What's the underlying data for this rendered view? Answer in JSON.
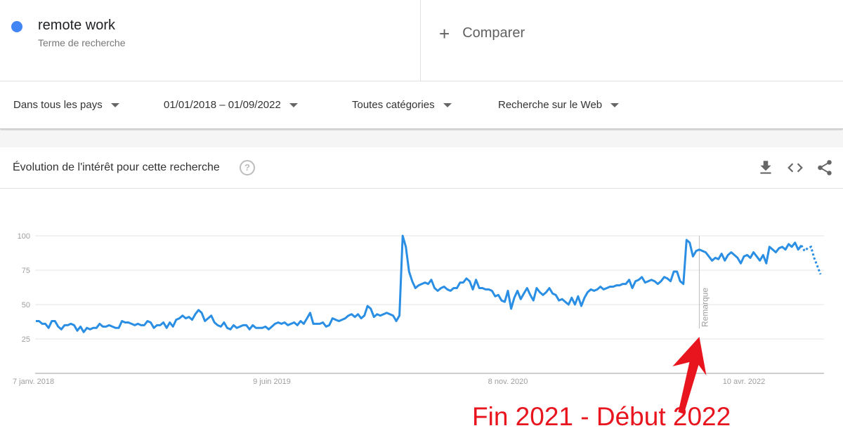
{
  "search_term": {
    "name": "remote work",
    "subtitle": "Terme de recherche",
    "color": "#4285f4"
  },
  "compare": {
    "label": "Comparer",
    "icon": "plus-icon"
  },
  "filters": {
    "region": "Dans tous les pays",
    "date_range": "01/01/2018 – 01/09/2022",
    "category": "Toutes catégories",
    "search_type": "Recherche sur le Web"
  },
  "card": {
    "title": "Évolution de l'intérêt pour cette recherche",
    "help_icon": "?",
    "actions": [
      "download-icon",
      "embed-icon",
      "share-icon"
    ]
  },
  "annotation": {
    "text": "Fin 2021 - Début 2022",
    "color": "#e8141e"
  },
  "chart_data": {
    "type": "line",
    "title": "Évolution de l'intérêt pour cette recherche",
    "xlabel": "",
    "ylabel": "",
    "ylim": [
      0,
      100
    ],
    "yticks": [
      25,
      50,
      75,
      100
    ],
    "xtick_labels": [
      "7 janv. 2018",
      "9 juin 2019",
      "8 nov. 2020",
      "10 avr. 2022"
    ],
    "xtick_index": [
      0,
      74,
      148,
      222
    ],
    "grid": true,
    "note_marker": {
      "label": "Remarque",
      "index": 208
    },
    "partial_data_from_index": 240,
    "series": [
      {
        "name": "remote work",
        "color": "#2a8fe4",
        "values": [
          38,
          38,
          36,
          36,
          33,
          38,
          38,
          34,
          32,
          35,
          35,
          36,
          35,
          31,
          34,
          30,
          33,
          32,
          33,
          33,
          36,
          34,
          34,
          35,
          34,
          33,
          33,
          38,
          37,
          37,
          36,
          35,
          36,
          35,
          35,
          38,
          37,
          33,
          35,
          35,
          37,
          33,
          37,
          34,
          39,
          40,
          42,
          40,
          41,
          39,
          43,
          46,
          44,
          38,
          40,
          42,
          37,
          35,
          34,
          37,
          33,
          32,
          35,
          33,
          34,
          35,
          35,
          32,
          35,
          33,
          33,
          33,
          34,
          32,
          34,
          36,
          37,
          36,
          37,
          35,
          36,
          37,
          35,
          38,
          36,
          40,
          44,
          36,
          36,
          36,
          37,
          34,
          35,
          40,
          39,
          38,
          39,
          40,
          42,
          43,
          41,
          43,
          40,
          42,
          49,
          47,
          41,
          43,
          42,
          43,
          44,
          43,
          42,
          38,
          42,
          100,
          92,
          74,
          67,
          62,
          64,
          65,
          66,
          65,
          68,
          62,
          60,
          62,
          63,
          61,
          60,
          62,
          62,
          66,
          66,
          69,
          67,
          61,
          68,
          62,
          62,
          61,
          61,
          60,
          56,
          57,
          53,
          52,
          60,
          47,
          55,
          60,
          54,
          58,
          62,
          57,
          53,
          62,
          59,
          57,
          59,
          62,
          58,
          57,
          53,
          54,
          52,
          50,
          55,
          50,
          56,
          49,
          55,
          59,
          61,
          60,
          61,
          63,
          61,
          62,
          63,
          63,
          64,
          64,
          65,
          65,
          68,
          62,
          67,
          68,
          70,
          66,
          67,
          68,
          67,
          65,
          67,
          70,
          69,
          67,
          74,
          74,
          67,
          65,
          97,
          95,
          85,
          89,
          90,
          89,
          88,
          85,
          82,
          84,
          83,
          87,
          82,
          86,
          88,
          86,
          84,
          80,
          85,
          86,
          84,
          88,
          85,
          82,
          86,
          80,
          92,
          90,
          88,
          91,
          92,
          90,
          94,
          92,
          95,
          90,
          93,
          89,
          91,
          92,
          84,
          78,
          72
        ]
      }
    ]
  }
}
